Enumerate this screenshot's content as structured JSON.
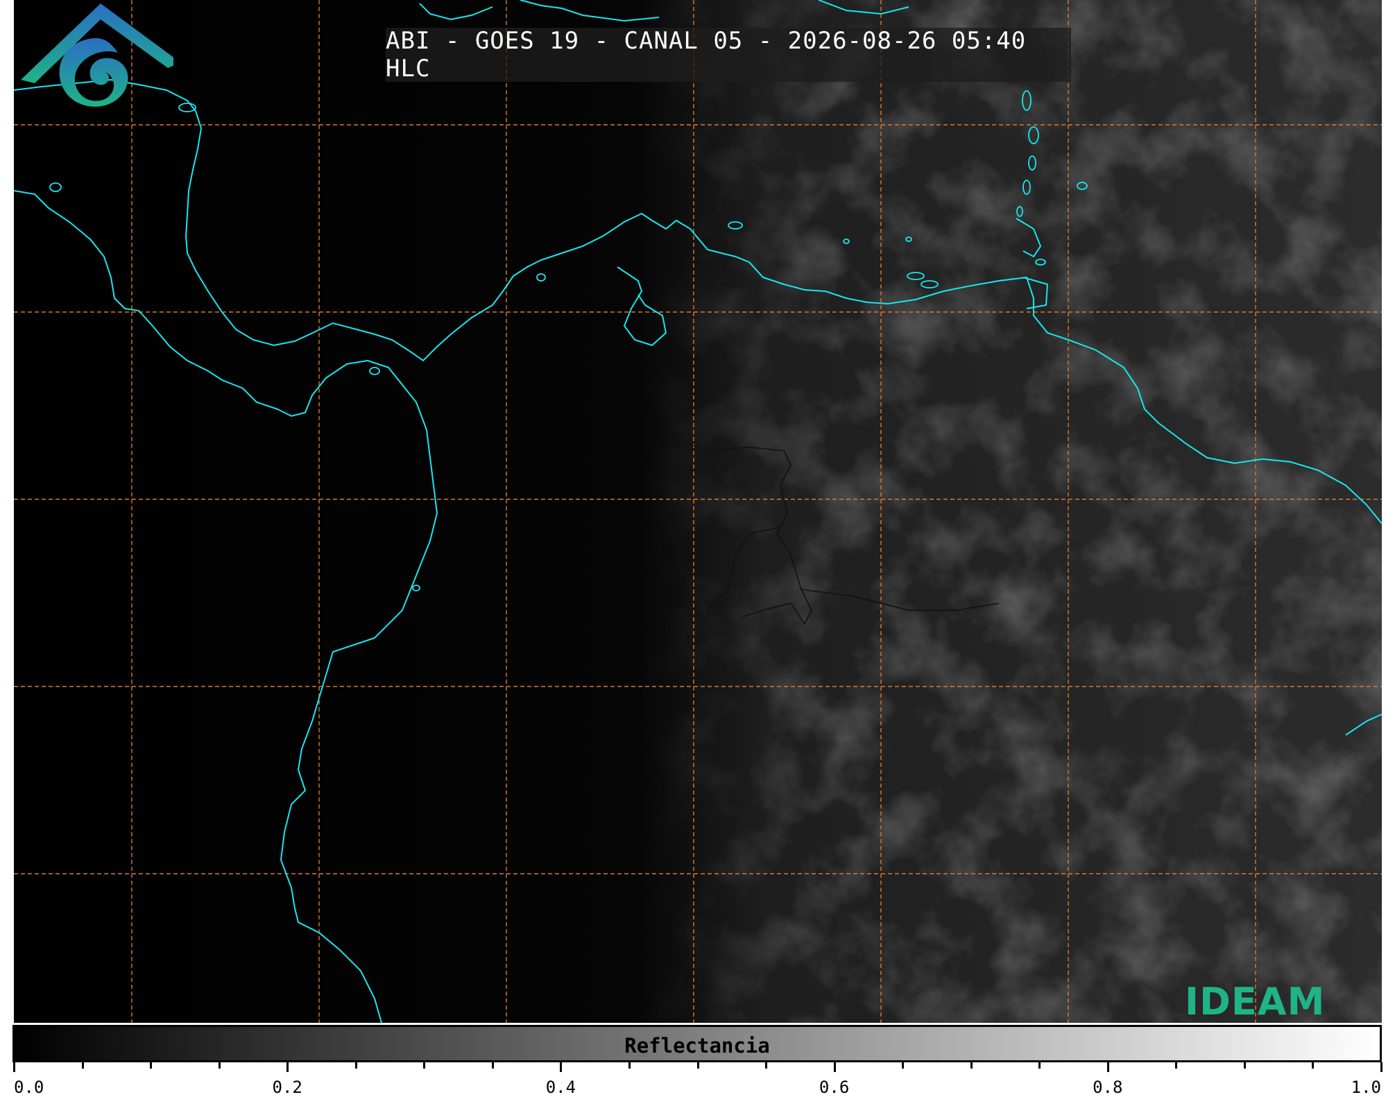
{
  "title": "ABI - GOES 19 - CANAL 05 - 2026-08-26 05:40 HLC",
  "logo": {
    "text": "IDEAM",
    "icon": "ideam-mountain-swirl-icon",
    "colors": [
      "#2a6fc4",
      "#1fb387"
    ]
  },
  "colorbar": {
    "label": "Reflectancia",
    "ticks": [
      "0.0",
      "0.2",
      "0.4",
      "0.6",
      "0.8",
      "1.0"
    ],
    "range": [
      0.0,
      1.0
    ],
    "colormap": "gray"
  },
  "colors": {
    "coastline": "#16e8f0",
    "gridline": "#e0782a",
    "borders": "#111111"
  },
  "gridlines": {
    "style": "dashed"
  }
}
